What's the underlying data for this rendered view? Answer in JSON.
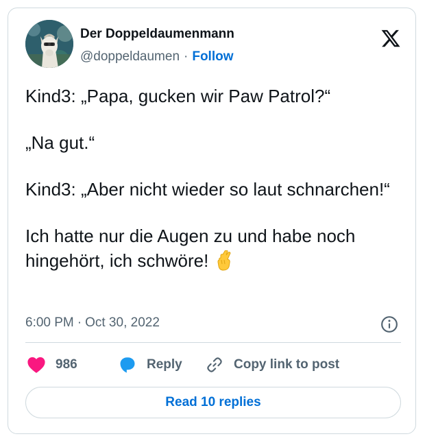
{
  "author": {
    "name": "Der Doppeldaumenmann",
    "handle": "@doppeldaumen",
    "separator": "·",
    "follow_label": "Follow"
  },
  "tweet": {
    "paragraphs": [
      "Kind3: „Papa, gucken wir Paw Patrol?“",
      "„Na gut.“",
      "Kind3: „Aber nicht wieder so laut schnarchen!“",
      "Ich hatte nur die Augen zu und habe noch hingehört, ich schwöre!"
    ],
    "emoji": "crossed-fingers-emoji"
  },
  "meta": {
    "time": "6:00 PM",
    "separator": "·",
    "date": "Oct 30, 2022"
  },
  "actions": {
    "like_count": "986",
    "reply_label": "Reply",
    "copy_label": "Copy link to post"
  },
  "footer": {
    "read_replies_label": "Read 10 replies"
  },
  "icons": {
    "brand": "x-logo-icon",
    "info": "info-icon",
    "like": "heart-icon",
    "reply": "speech-bubble-icon",
    "copy": "link-icon"
  },
  "colors": {
    "like": "#f91880",
    "reply": "#1d9bf0",
    "link": "#006fd6",
    "muted": "#536471",
    "text": "#0f1419",
    "border": "#cfd9de"
  }
}
